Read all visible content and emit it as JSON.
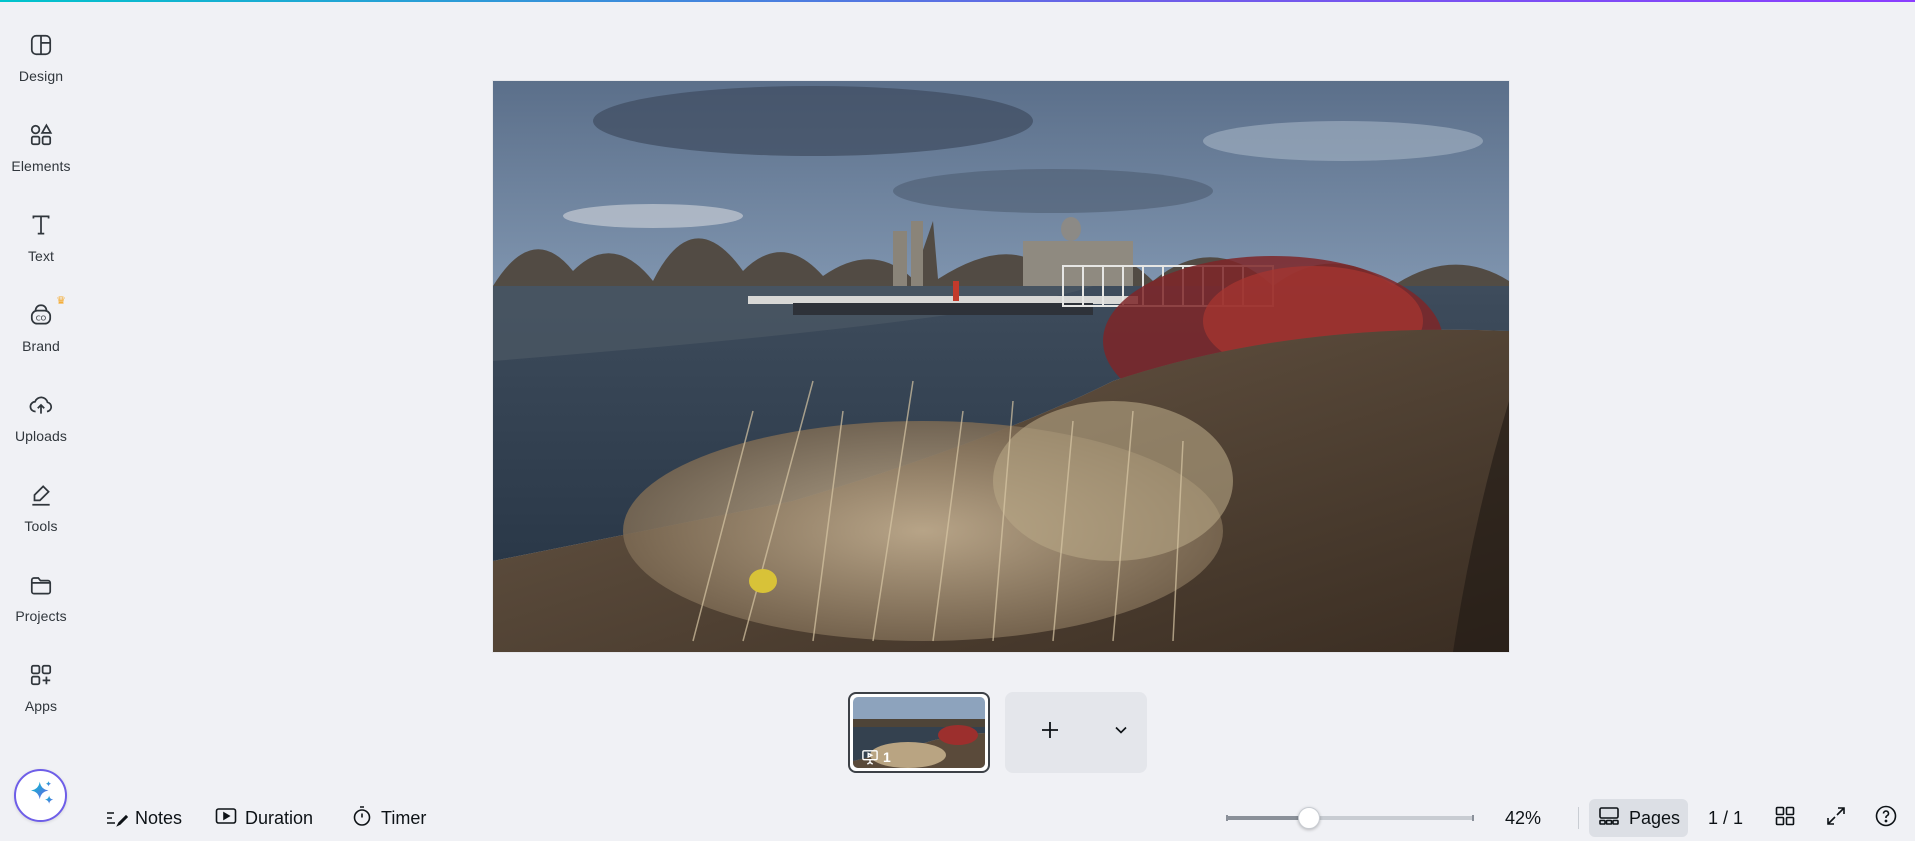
{
  "sidebar": {
    "items": [
      {
        "label": "Design",
        "icon": "design-icon"
      },
      {
        "label": "Elements",
        "icon": "elements-icon"
      },
      {
        "label": "Text",
        "icon": "text-icon"
      },
      {
        "label": "Brand",
        "icon": "brand-icon",
        "badge": "crown"
      },
      {
        "label": "Uploads",
        "icon": "upload-cloud-icon"
      },
      {
        "label": "Tools",
        "icon": "pen-tool-icon"
      },
      {
        "label": "Projects",
        "icon": "folder-icon"
      },
      {
        "label": "Apps",
        "icon": "apps-grid-icon"
      }
    ],
    "magic_button_icon": "sparkle-icon"
  },
  "canvas": {
    "image_description_icon": "lake-landscape-photo"
  },
  "pages": {
    "thumbnails": [
      {
        "number": "1"
      }
    ],
    "add_icon": "plus-icon",
    "more_icon": "chevron-down-icon"
  },
  "bottom_bar": {
    "notes_label": "Notes",
    "duration_label": "Duration",
    "timer_label": "Timer",
    "zoom_percent": 42,
    "zoom_label": "42%",
    "pages_label": "Pages",
    "page_count": "1 / 1"
  },
  "colors": {
    "accent": "#6e5ee8",
    "background": "#f0f1f5",
    "crown": "#f5a623"
  }
}
